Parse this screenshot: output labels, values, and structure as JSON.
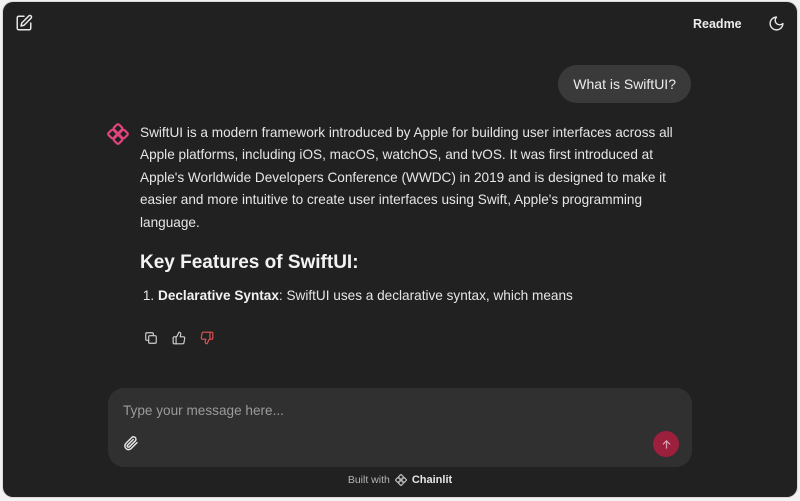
{
  "header": {
    "readme_label": "Readme",
    "icons": {
      "new_chat": "edit-square-icon",
      "theme": "moon-icon"
    }
  },
  "conversation": {
    "user_message": "What is SwiftUI?",
    "assistant": {
      "avatar_icon": "chainlit-logo-icon",
      "paragraph": "SwiftUI is a modern framework introduced by Apple for building user interfaces across all Apple platforms, including iOS, macOS, watchOS, and tvOS. It was first introduced at Apple's Worldwide Developers Conference (WWDC) in 2019 and is designed to make it easier and more intuitive to create user interfaces using Swift, Apple's programming language.",
      "heading": "Key Features of SwiftUI:",
      "list": [
        {
          "number": "1.",
          "term": "Declarative Syntax",
          "text": ": SwiftUI uses a declarative syntax, which means"
        }
      ],
      "actions": [
        "copy-icon",
        "thumbs-up-icon",
        "thumbs-down-icon"
      ]
    }
  },
  "composer": {
    "placeholder": "Type your message here...",
    "value": "",
    "attach_icon": "paperclip-icon",
    "send_icon": "arrow-up-icon"
  },
  "footer": {
    "built_with": "Built with",
    "brand": "Chainlit"
  },
  "colors": {
    "background": "#212121",
    "bubble": "#3a3a3a",
    "composer": "#303030",
    "accent": "#e0457b",
    "send": "#9c1f3e",
    "dislike": "#e05252"
  }
}
